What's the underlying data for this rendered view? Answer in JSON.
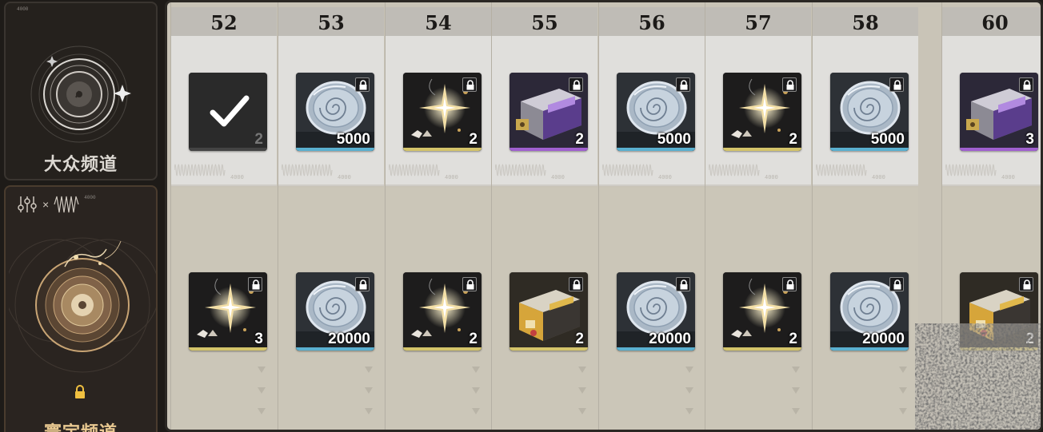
{
  "channels": {
    "basic": {
      "title": "大众频道",
      "code": "4000"
    },
    "premium": {
      "title": "寰宇频道",
      "code": "4000",
      "times": "×"
    }
  },
  "track": {
    "columns": [
      {
        "level": "52",
        "upper": {
          "item": "check",
          "qty": "2",
          "claimed": true,
          "bar": "#444444"
        },
        "lower": {
          "item": "spark",
          "qty": "3",
          "locked": true,
          "bar": "#d4c46a"
        }
      },
      {
        "level": "53",
        "upper": {
          "item": "credit",
          "qty": "5000",
          "locked": true,
          "bar": "#5ab0d0"
        },
        "lower": {
          "item": "credit",
          "qty": "20000",
          "locked": true,
          "bar": "#5ab0d0"
        }
      },
      {
        "level": "54",
        "upper": {
          "item": "spark",
          "qty": "2",
          "locked": true,
          "bar": "#d4c46a"
        },
        "lower": {
          "item": "spark",
          "qty": "2",
          "locked": true,
          "bar": "#d4c46a"
        }
      },
      {
        "level": "55",
        "upper": {
          "item": "box-purple",
          "qty": "2",
          "locked": true,
          "bar": "#a060d0"
        },
        "lower": {
          "item": "box-gold",
          "qty": "2",
          "locked": true,
          "bar": "#d4c46a"
        }
      },
      {
        "level": "56",
        "upper": {
          "item": "credit",
          "qty": "5000",
          "locked": true,
          "bar": "#5ab0d0"
        },
        "lower": {
          "item": "credit",
          "qty": "20000",
          "locked": true,
          "bar": "#5ab0d0"
        }
      },
      {
        "level": "57",
        "upper": {
          "item": "spark",
          "qty": "2",
          "locked": true,
          "bar": "#d4c46a"
        },
        "lower": {
          "item": "spark",
          "qty": "2",
          "locked": true,
          "bar": "#d4c46a"
        }
      },
      {
        "level": "58",
        "upper": {
          "item": "credit",
          "qty": "5000",
          "locked": true,
          "bar": "#5ab0d0"
        },
        "lower": {
          "item": "credit",
          "qty": "20000",
          "locked": true,
          "bar": "#5ab0d0"
        }
      },
      {
        "level": "60",
        "upper": {
          "item": "box-purple",
          "qty": "3",
          "locked": true,
          "bar": "#a060d0"
        },
        "lower": {
          "item": "box-gold",
          "qty": "2",
          "locked": true,
          "bar": "#d4c46a"
        }
      }
    ],
    "wave_label": "4000"
  },
  "colors": {
    "accent_gold": "#e8c890",
    "bar_blue": "#5ab0d0",
    "bar_purple": "#a060d0",
    "bar_yellow": "#d4c46a"
  }
}
